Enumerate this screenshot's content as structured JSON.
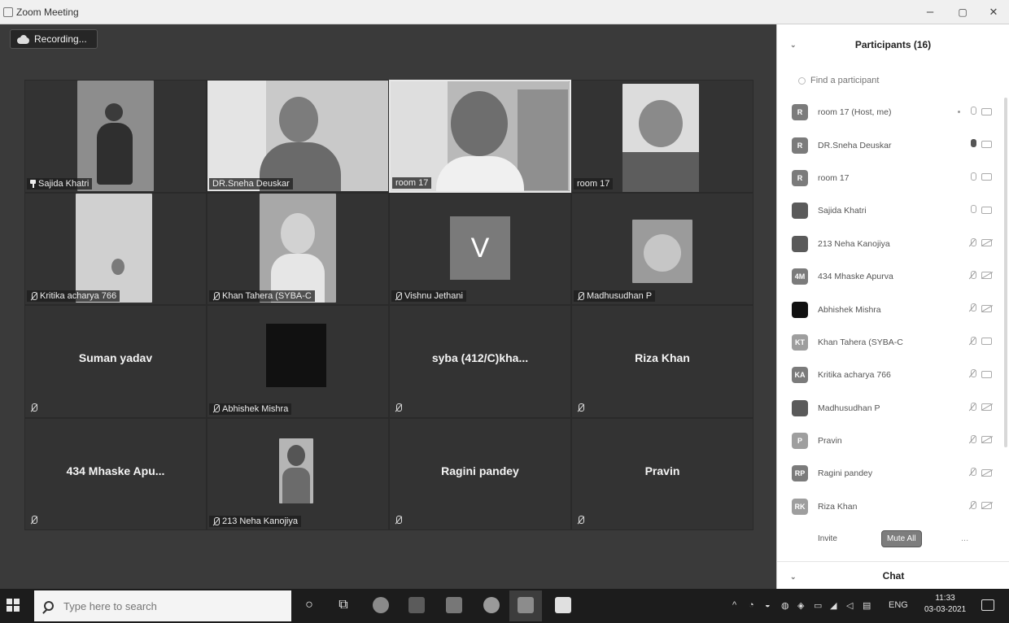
{
  "window": {
    "title": "Zoom Meeting",
    "controls": [
      "–",
      "▢",
      "✕"
    ]
  },
  "meeting": {
    "recording_label": "Recording...",
    "tiles": [
      {
        "name": "Sajida Khatri",
        "kind": "video",
        "pinned": true
      },
      {
        "name": "DR.Sneha Deuskar",
        "kind": "video"
      },
      {
        "name": "room 17",
        "kind": "video",
        "active_speaker": true
      },
      {
        "name": "room 17",
        "kind": "video"
      },
      {
        "name": "Kritika acharya 766",
        "kind": "video",
        "muted": true
      },
      {
        "name": "Khan Tahera (SYBA-C",
        "kind": "video",
        "muted": true
      },
      {
        "name": "Vishnu Jethani",
        "kind": "avatar",
        "initial": "V",
        "muted": true
      },
      {
        "name": "Madhusudhan P",
        "kind": "video",
        "muted": true
      },
      {
        "name": "Suman yadav",
        "kind": "name_only",
        "muted": true
      },
      {
        "name": "Abhishek Mishra",
        "kind": "black",
        "muted": true
      },
      {
        "name": "syba (412/C)kha...",
        "kind": "name_only",
        "muted": true
      },
      {
        "name": "Riza Khan",
        "kind": "name_only",
        "muted": true
      },
      {
        "name": "434 Mhaske Apu...",
        "kind": "name_only",
        "muted": true
      },
      {
        "name": "213 Neha Kanojiya",
        "kind": "video",
        "muted": true
      },
      {
        "name": "Ragini pandey",
        "kind": "name_only",
        "muted": true
      },
      {
        "name": "Pravin",
        "kind": "name_only",
        "muted": true
      }
    ]
  },
  "participants_panel": {
    "title": "Participants (16)",
    "search_placeholder": "Find a participant",
    "participants": [
      {
        "initials": "R",
        "name": "room 17 (Host, me)",
        "mic": "off",
        "cam": "off",
        "style": "plain"
      },
      {
        "initials": "R",
        "name": "DR.Sneha Deuskar",
        "mic": "on",
        "cam": "off",
        "style": "plain"
      },
      {
        "initials": "R",
        "name": "room 17",
        "mic": "off",
        "cam": "off",
        "style": "plain"
      },
      {
        "initials": "",
        "name": "Sajida Khatri",
        "mic": "off",
        "cam": "off",
        "style": "photo"
      },
      {
        "initials": "",
        "name": "213 Neha Kanojiya",
        "mic": "muted",
        "cam": "muted",
        "style": "photo"
      },
      {
        "initials": "4M",
        "name": "434 Mhaske Apurva",
        "mic": "muted",
        "cam": "muted",
        "style": "plain"
      },
      {
        "initials": "",
        "name": "Abhishek Mishra",
        "mic": "muted",
        "cam": "muted",
        "style": "dark"
      },
      {
        "initials": "KT",
        "name": "Khan Tahera (SYBA-C",
        "mic": "muted",
        "cam": "off",
        "style": "light"
      },
      {
        "initials": "KA",
        "name": "Kritika acharya 766",
        "mic": "muted",
        "cam": "off",
        "style": "plain"
      },
      {
        "initials": "",
        "name": "Madhusudhan P",
        "mic": "muted",
        "cam": "muted",
        "style": "photo"
      },
      {
        "initials": "P",
        "name": "Pravin",
        "mic": "muted",
        "cam": "muted",
        "style": "light"
      },
      {
        "initials": "RP",
        "name": "Ragini pandey",
        "mic": "muted",
        "cam": "muted",
        "style": "plain"
      },
      {
        "initials": "RK",
        "name": "Riza Khan",
        "mic": "muted",
        "cam": "muted",
        "style": "light"
      }
    ],
    "invite_label": "Invite",
    "mute_all_label": "Mute All",
    "more_label": "...",
    "chat_label": "Chat"
  },
  "taskbar": {
    "search_placeholder": "Type here to search",
    "language": "ENG",
    "time": "11:33",
    "date": "03-03-2021"
  }
}
